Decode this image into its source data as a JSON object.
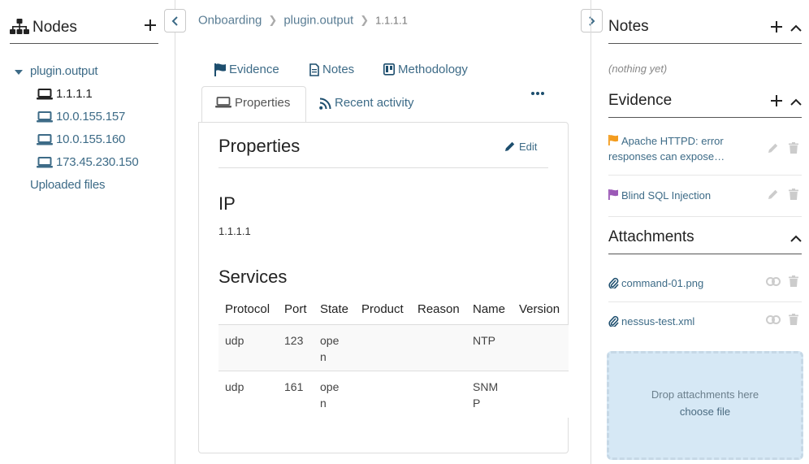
{
  "left_sidebar": {
    "title": "Nodes",
    "tree": {
      "root": "plugin.output",
      "nodes": [
        "1.1.1.1",
        "10.0.155.157",
        "10.0.155.160",
        "173.45.230.150"
      ],
      "selected": "1.1.1.1"
    },
    "uploaded_files": "Uploaded files"
  },
  "breadcrumb": {
    "items": [
      "Onboarding",
      "plugin.output",
      "1.1.1.1"
    ]
  },
  "tabs": {
    "evidence": "Evidence",
    "notes": "Notes",
    "methodology": "Methodology",
    "properties": "Properties",
    "recent_activity": "Recent activity"
  },
  "properties": {
    "title": "Properties",
    "edit_label": "Edit",
    "ip_heading": "IP",
    "ip_value": "1.1.1.1",
    "services_heading": "Services",
    "services": {
      "headers": [
        "Protocol",
        "Port",
        "State",
        "Product",
        "Reason",
        "Name",
        "Version"
      ],
      "rows": [
        {
          "protocol": "udp",
          "port": "123",
          "state_1": "ope",
          "state_2": "n",
          "product": "",
          "reason": "",
          "name_1": "NTP",
          "name_2": "",
          "version": ""
        },
        {
          "protocol": "udp",
          "port": "161",
          "state_1": "ope",
          "state_2": "n",
          "product": "",
          "reason": "",
          "name_1": "SNM",
          "name_2": "P",
          "version": ""
        }
      ]
    }
  },
  "right_sidebar": {
    "notes": {
      "title": "Notes",
      "empty_text": "(nothing yet)"
    },
    "evidence": {
      "title": "Evidence",
      "items": [
        {
          "text": "Apache HTTPD: error responses can expose…",
          "flag_color": "#f39c1f"
        },
        {
          "text": "Blind SQL Injection",
          "flag_color": "#9b59b6"
        }
      ]
    },
    "attachments": {
      "title": "Attachments",
      "items": [
        "command-01.png",
        "nessus-test.xml"
      ],
      "dropzone_text": "Drop attachments here",
      "dropzone_link": "choose file"
    }
  },
  "colors": {
    "link": "#3d6b87",
    "dropzone_bg": "#d6e8f5"
  }
}
